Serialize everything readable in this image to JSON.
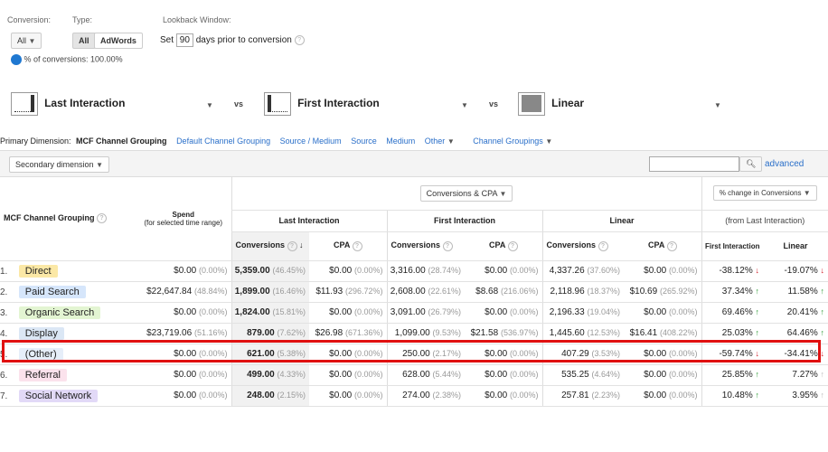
{
  "top": {
    "conversion_label": "Conversion:",
    "conversion_value": "All",
    "type_label": "Type:",
    "type_all": "All",
    "type_adwords": "AdWords",
    "lookback_label": "Lookback Window:",
    "lookback_set": "Set",
    "lookback_value": "90",
    "lookback_suffix": "days prior to conversion",
    "percent_conversions": "% of conversions: 100.00%"
  },
  "models": [
    {
      "name": "Last Interaction",
      "icon": "last-interaction-model-icon"
    },
    {
      "name": "First Interaction",
      "icon": "first-interaction-model-icon"
    },
    {
      "name": "Linear",
      "icon": "linear-model-icon"
    }
  ],
  "vs": "vs",
  "dimension": {
    "label": "Primary Dimension:",
    "active": "MCF Channel Grouping",
    "links": [
      "Default Channel Grouping",
      "Source / Medium",
      "Source",
      "Medium",
      "Other"
    ],
    "channel_groupings": "Channel Groupings"
  },
  "secondary_dimension": "Secondary dimension",
  "search_placeholder": "",
  "advanced": "advanced",
  "table": {
    "metric_select": "Conversions & CPA",
    "change_select": "% change in Conversions",
    "change_sub": "(from Last Interaction)",
    "col_channel": "MCF Channel Grouping",
    "col_spend": "Spend",
    "col_spend_sub": "(for selected time range)",
    "group_last": "Last Interaction",
    "group_first": "First Interaction",
    "group_linear": "Linear",
    "h_conversions": "Conversions",
    "h_cpa": "CPA",
    "h_first": "First Interaction",
    "h_linear": "Linear",
    "rows": [
      {
        "idx": "1.",
        "name": "Direct",
        "color": "#fbe8a6",
        "spend": "$0.00",
        "spend_pct": "(0.00%)",
        "lc": "5,359.00",
        "lc_pct": "(46.45%)",
        "lcpa": "$0.00",
        "lcpa_pct": "(0.00%)",
        "fc": "3,316.00",
        "fc_pct": "(28.74%)",
        "fcpa": "$0.00",
        "fcpa_pct": "(0.00%)",
        "lin": "4,337.26",
        "lin_pct": "(37.60%)",
        "lincpa": "$0.00",
        "lincpa_pct": "(0.00%)",
        "chg_first": "-38.12%",
        "dir_first": "down",
        "chg_linear": "-19.07%",
        "dir_linear": "down"
      },
      {
        "idx": "2.",
        "name": "Paid Search",
        "color": "#d6e6fb",
        "spend": "$22,647.84",
        "spend_pct": "(48.84%)",
        "lc": "1,899.00",
        "lc_pct": "(16.46%)",
        "lcpa": "$11.93",
        "lcpa_pct": "(296.72%)",
        "fc": "2,608.00",
        "fc_pct": "(22.61%)",
        "fcpa": "$8.68",
        "fcpa_pct": "(216.06%)",
        "lin": "2,118.96",
        "lin_pct": "(18.37%)",
        "lincpa": "$10.69",
        "lincpa_pct": "(265.92%)",
        "chg_first": "37.34%",
        "dir_first": "up",
        "chg_linear": "11.58%",
        "dir_linear": "up"
      },
      {
        "idx": "3.",
        "name": "Organic Search",
        "color": "#e3f5d2",
        "spend": "$0.00",
        "spend_pct": "(0.00%)",
        "lc": "1,824.00",
        "lc_pct": "(15.81%)",
        "lcpa": "$0.00",
        "lcpa_pct": "(0.00%)",
        "fc": "3,091.00",
        "fc_pct": "(26.79%)",
        "fcpa": "$0.00",
        "fcpa_pct": "(0.00%)",
        "lin": "2,196.33",
        "lin_pct": "(19.04%)",
        "lincpa": "$0.00",
        "lincpa_pct": "(0.00%)",
        "chg_first": "69.46%",
        "dir_first": "up",
        "chg_linear": "20.41%",
        "dir_linear": "up"
      },
      {
        "idx": "4.",
        "name": "Display",
        "color": "#dbe7f5",
        "spend": "$23,719.06",
        "spend_pct": "(51.16%)",
        "lc": "879.00",
        "lc_pct": "(7.62%)",
        "lcpa": "$26.98",
        "lcpa_pct": "(671.36%)",
        "fc": "1,099.00",
        "fc_pct": "(9.53%)",
        "fcpa": "$21.58",
        "fcpa_pct": "(536.97%)",
        "lin": "1,445.60",
        "lin_pct": "(12.53%)",
        "lincpa": "$16.41",
        "lincpa_pct": "(408.22%)",
        "chg_first": "25.03%",
        "dir_first": "up",
        "chg_linear": "64.46%",
        "dir_linear": "up"
      },
      {
        "idx": "5.",
        "name": "(Other)",
        "color": "#e6eef9",
        "spend": "$0.00",
        "spend_pct": "(0.00%)",
        "lc": "621.00",
        "lc_pct": "(5.38%)",
        "lcpa": "$0.00",
        "lcpa_pct": "(0.00%)",
        "fc": "250.00",
        "fc_pct": "(2.17%)",
        "fcpa": "$0.00",
        "fcpa_pct": "(0.00%)",
        "lin": "407.29",
        "lin_pct": "(3.53%)",
        "lincpa": "$0.00",
        "lincpa_pct": "(0.00%)",
        "chg_first": "-59.74%",
        "dir_first": "down",
        "chg_linear": "-34.41%",
        "dir_linear": "down"
      },
      {
        "idx": "6.",
        "name": "Referral",
        "color": "#fbe2ec",
        "spend": "$0.00",
        "spend_pct": "(0.00%)",
        "lc": "499.00",
        "lc_pct": "(4.33%)",
        "lcpa": "$0.00",
        "lcpa_pct": "(0.00%)",
        "fc": "628.00",
        "fc_pct": "(5.44%)",
        "fcpa": "$0.00",
        "fcpa_pct": "(0.00%)",
        "lin": "535.25",
        "lin_pct": "(4.64%)",
        "lincpa": "$0.00",
        "lincpa_pct": "(0.00%)",
        "chg_first": "25.85%",
        "dir_first": "up",
        "chg_linear": "7.27%",
        "dir_linear": "neutral"
      },
      {
        "idx": "7.",
        "name": "Social Network",
        "color": "#e2d9f7",
        "spend": "$0.00",
        "spend_pct": "(0.00%)",
        "lc": "248.00",
        "lc_pct": "(2.15%)",
        "lcpa": "$0.00",
        "lcpa_pct": "(0.00%)",
        "fc": "274.00",
        "fc_pct": "(2.38%)",
        "fcpa": "$0.00",
        "fcpa_pct": "(0.00%)",
        "lin": "257.81",
        "lin_pct": "(2.23%)",
        "lincpa": "$0.00",
        "lincpa_pct": "(0.00%)",
        "chg_first": "10.48%",
        "dir_first": "up",
        "chg_linear": "3.95%",
        "dir_linear": "neutral"
      }
    ]
  }
}
